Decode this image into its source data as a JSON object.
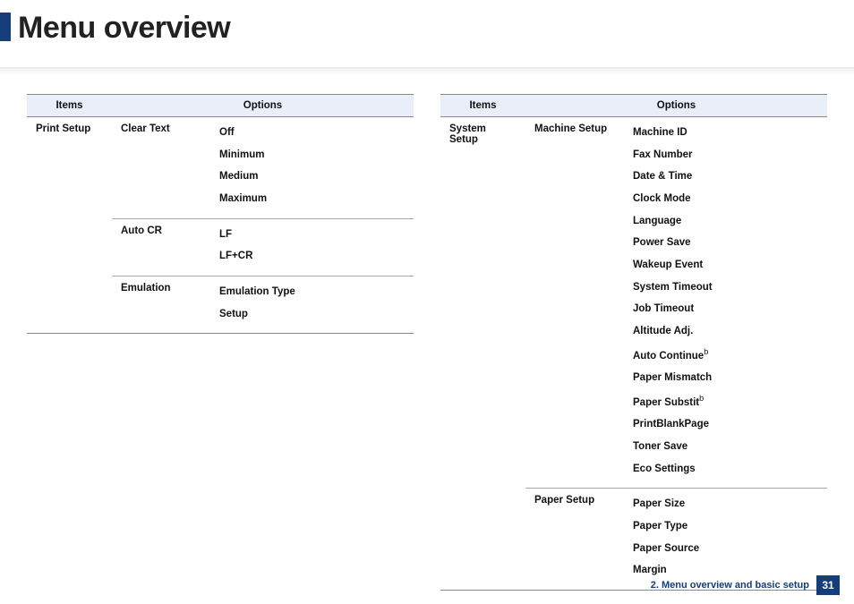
{
  "page_title": "Menu overview",
  "header": {
    "items": "Items",
    "options": "Options"
  },
  "left": {
    "category": "Print Setup",
    "rows": [
      {
        "label": "Clear Text",
        "options": [
          "Off",
          "Minimum",
          "Medium",
          "Maximum"
        ]
      },
      {
        "label": "Auto CR",
        "options": [
          "LF",
          "LF+CR"
        ]
      },
      {
        "label": "Emulation",
        "options": [
          "Emulation Type",
          "Setup"
        ]
      }
    ]
  },
  "right": {
    "category": "System Setup",
    "rows": [
      {
        "label": "Machine Setup",
        "options": [
          "Machine ID",
          "Fax Number",
          "Date & Time",
          "Clock Mode",
          "Language",
          "Power Save",
          "Wakeup Event",
          "System Timeout",
          "Job Timeout",
          "Altitude Adj.",
          {
            "text": "Auto Continue",
            "sup": "b"
          },
          "Paper Mismatch",
          {
            "text": "Paper Substit",
            "sup": "b"
          },
          "PrintBlankPage",
          "Toner Save",
          "Eco Settings"
        ]
      },
      {
        "label": "Paper Setup",
        "options": [
          "Paper Size",
          "Paper Type",
          "Paper Source",
          "Margin"
        ]
      }
    ]
  },
  "footer": {
    "label": "2. Menu overview and basic setup",
    "page": "31"
  }
}
